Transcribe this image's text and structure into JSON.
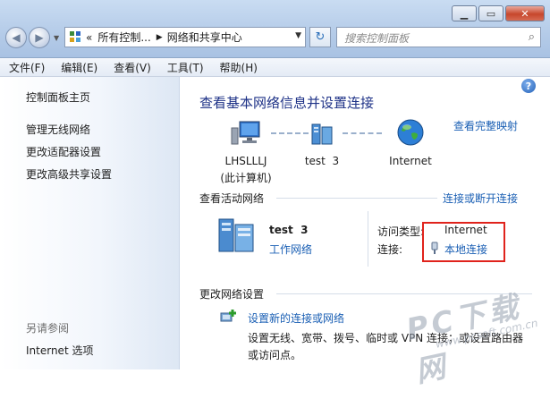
{
  "address_bar": {
    "overflow": "«",
    "crumbs": [
      "所有控制...",
      "网络和共享中心"
    ]
  },
  "search": {
    "placeholder": "搜索控制面板"
  },
  "menu": [
    "文件(F)",
    "编辑(E)",
    "查看(V)",
    "工具(T)",
    "帮助(H)"
  ],
  "sidebar": {
    "items": [
      "控制面板主页",
      "管理无线网络",
      "更改适配器设置",
      "更改高级共享设置"
    ],
    "see_also_heading": "另请参阅",
    "see_also": [
      "Internet 选项"
    ]
  },
  "main": {
    "title": "查看基本网络信息并设置连接",
    "full_map_link": "查看完整映射",
    "map": {
      "computer_name": "LHSLLLJ",
      "computer_sub": "(此计算机)",
      "network": "test  3",
      "internet": "Internet"
    },
    "active": {
      "heading": "查看活动网络",
      "connect_link": "连接或断开连接",
      "network_name": "test  3",
      "network_type": "工作网络",
      "access_label": "访问类型:",
      "access_value": "Internet",
      "conn_label": "连接:",
      "conn_value": "本地连接"
    },
    "change": {
      "heading": "更改网络设置",
      "task_link": "设置新的连接或网络",
      "task_desc": "设置无线、宽带、拨号、临时或 VPN 连接；或设置路由器或访问点。"
    }
  },
  "watermark": {
    "text": "PC下载网",
    "url": "www.pcsoft.com.cn"
  },
  "colors": {
    "highlight": "#e0231c",
    "link": "#1a5fb4",
    "title": "#1e3287"
  }
}
